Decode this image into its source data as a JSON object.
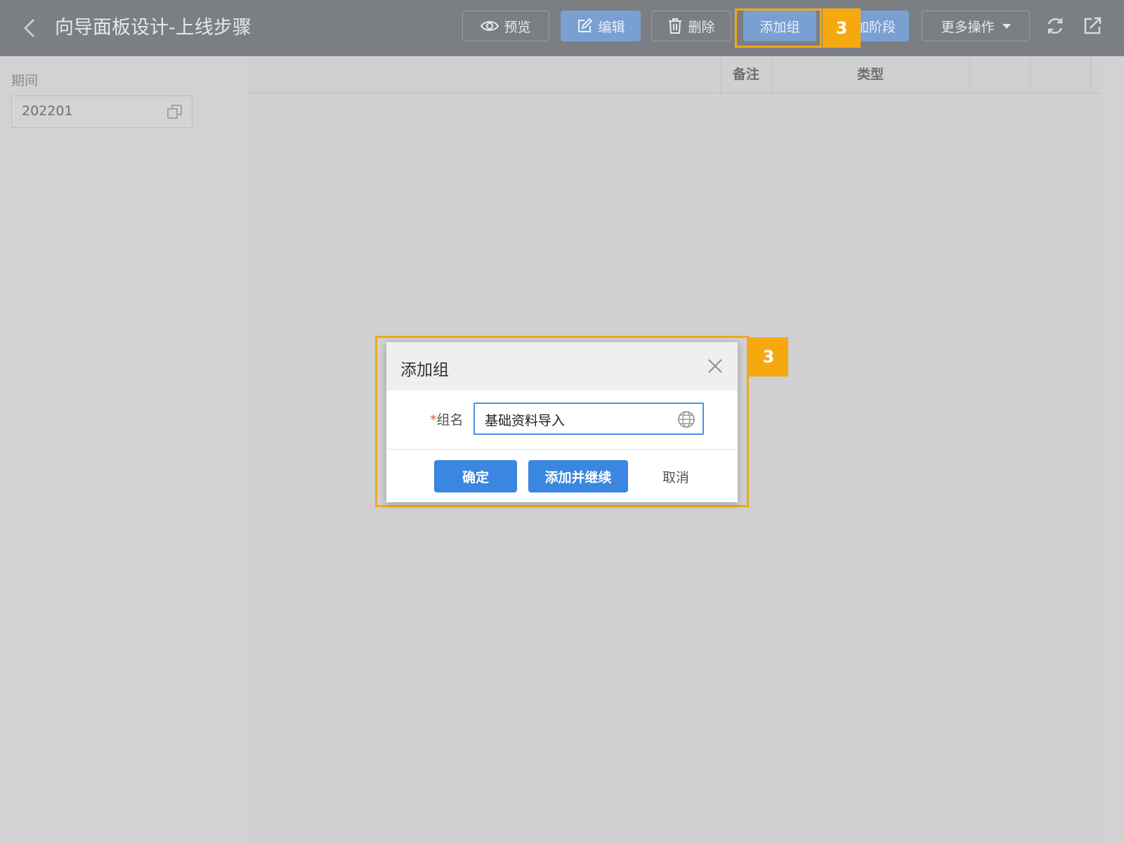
{
  "header": {
    "back_icon": "chevron-left-icon",
    "title": "向导面板设计-上线步骤",
    "buttons": {
      "preview": "预览",
      "edit": "编辑",
      "delete": "删除",
      "add_group": "添加组",
      "add_stage": "加阶段",
      "more_actions": "更多操作"
    }
  },
  "annotation": {
    "step_number": "3",
    "color": "#f6a90f"
  },
  "filter": {
    "label": "期间",
    "value": "202201"
  },
  "table": {
    "columns": [
      "备注",
      "类型"
    ]
  },
  "dialog": {
    "title": "添加组",
    "field_label": "组名",
    "required_mark": "*",
    "field_value": "基础资料导入",
    "confirm": "确定",
    "add_continue": "添加并继续",
    "cancel": "取消"
  },
  "colors": {
    "topbar": "#7b7e82",
    "primary_blue": "#3a86e0",
    "highlight": "#f0a81c"
  }
}
